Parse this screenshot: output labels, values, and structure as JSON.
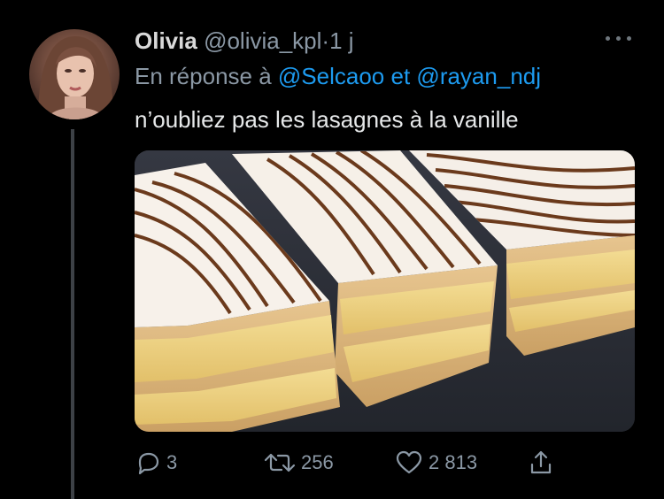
{
  "tweet": {
    "author_name": "Olivia",
    "author_handle": "@olivia_kpl",
    "separator": "·",
    "time": "1 j",
    "reply_prefix": "En réponse à",
    "reply_mention_1": "@Selcaoo",
    "reply_conjunction": "et",
    "reply_mention_2": "@rayan_ndj",
    "text": "n’oubliez pas les lasagnes à la vanille",
    "media_alt": "Photo de trois mille-feuilles glacés",
    "colors": {
      "background": "#000000",
      "mention": "#1d9bf0",
      "secondary_text": "#8b98a5",
      "primary_text": "#e7e9ea"
    }
  },
  "actions": {
    "reply": {
      "icon": "reply-icon",
      "count": "3"
    },
    "retweet": {
      "icon": "retweet-icon",
      "count": "256"
    },
    "like": {
      "icon": "heart-icon",
      "count": "2 813"
    },
    "share": {
      "icon": "share-icon"
    }
  }
}
